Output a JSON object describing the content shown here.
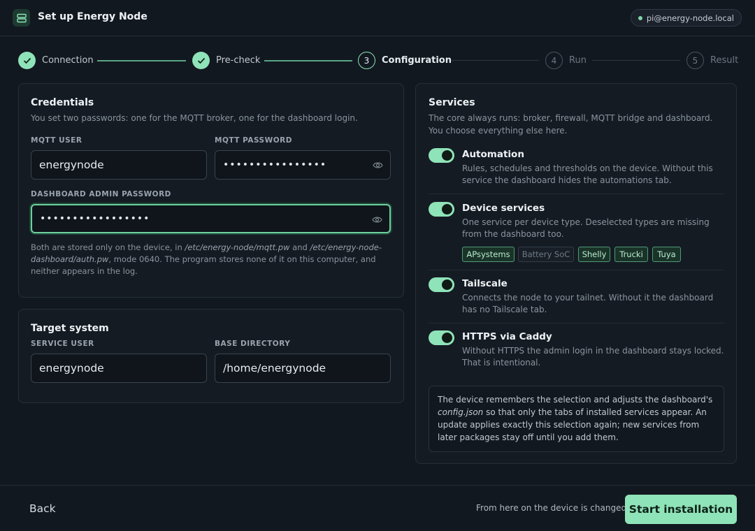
{
  "header": {
    "title": "Set up Energy Node",
    "host": "pi@energy-node.local",
    "app_icon": "server-icon"
  },
  "stepper": {
    "steps": [
      {
        "label": "Connection",
        "state": "done",
        "marker": "✓"
      },
      {
        "label": "Pre-check",
        "state": "done",
        "marker": "✓"
      },
      {
        "label": "Configuration",
        "state": "active",
        "marker": "3"
      },
      {
        "label": "Run",
        "state": "pending",
        "marker": "4"
      },
      {
        "label": "Result",
        "state": "pending",
        "marker": "5"
      }
    ]
  },
  "credentials": {
    "title": "Credentials",
    "subtitle": "You set two passwords: one for the MQTT broker, one for the dashboard login.",
    "mqtt_user_label": "MQTT USER",
    "mqtt_user_value": "energynode",
    "mqtt_password_label": "MQTT PASSWORD",
    "mqtt_password_value": "••••••••••••••••",
    "dashboard_password_label": "DASHBOARD ADMIN PASSWORD",
    "dashboard_password_value": "•••••••••••••••••",
    "note_1": "Both are stored only on the device, in ",
    "note_path_1": "/etc/energy-node/mqtt.pw",
    "note_2": " and ",
    "note_path_2": "/etc/energy-node-dashboard/auth.pw",
    "note_3": ", mode 0640. The program stores none of it on this computer, and neither appears in the log."
  },
  "target": {
    "title": "Target system",
    "service_user_label": "SERVICE USER",
    "service_user_value": "energynode",
    "base_dir_label": "BASE DIRECTORY",
    "base_dir_value": "/home/energynode"
  },
  "services": {
    "title": "Services",
    "subtitle": "The core always runs: broker, firewall, MQTT bridge and dashboard. You choose everything else here.",
    "items": [
      {
        "name": "Automation",
        "desc": "Rules, schedules and thresholds on the device. Without this service the dashboard hides the automations tab.",
        "enabled": true
      },
      {
        "name": "Device services",
        "desc": "One service per device type. Deselected types are missing from the dashboard too.",
        "enabled": true
      },
      {
        "name": "Tailscale",
        "desc": "Connects the node to your tailnet. Without it the dashboard has no Tailscale tab.",
        "enabled": true
      },
      {
        "name": "HTTPS via Caddy",
        "desc": "Without HTTPS the admin login in the dashboard stays locked. That is intentional.",
        "enabled": true
      }
    ],
    "device_types": [
      {
        "label": "APsystems",
        "selected": true
      },
      {
        "label": "Battery SoC",
        "selected": false
      },
      {
        "label": "Shelly",
        "selected": true
      },
      {
        "label": "Trucki",
        "selected": true
      },
      {
        "label": "Tuya",
        "selected": true
      }
    ],
    "info_1": "The device remembers the selection and adjusts the dashboard's ",
    "info_file": "config.json",
    "info_2": " so that only the tabs of installed services appear. An update applies exactly this selection again; new services from later packages stay off until you add them."
  },
  "footer": {
    "back_label": "Back",
    "hint": "From here on the device is changed",
    "start_label": "Start installation"
  },
  "colors": {
    "accent": "#8fe3b8",
    "background": "#121820",
    "card": "#141b23"
  }
}
